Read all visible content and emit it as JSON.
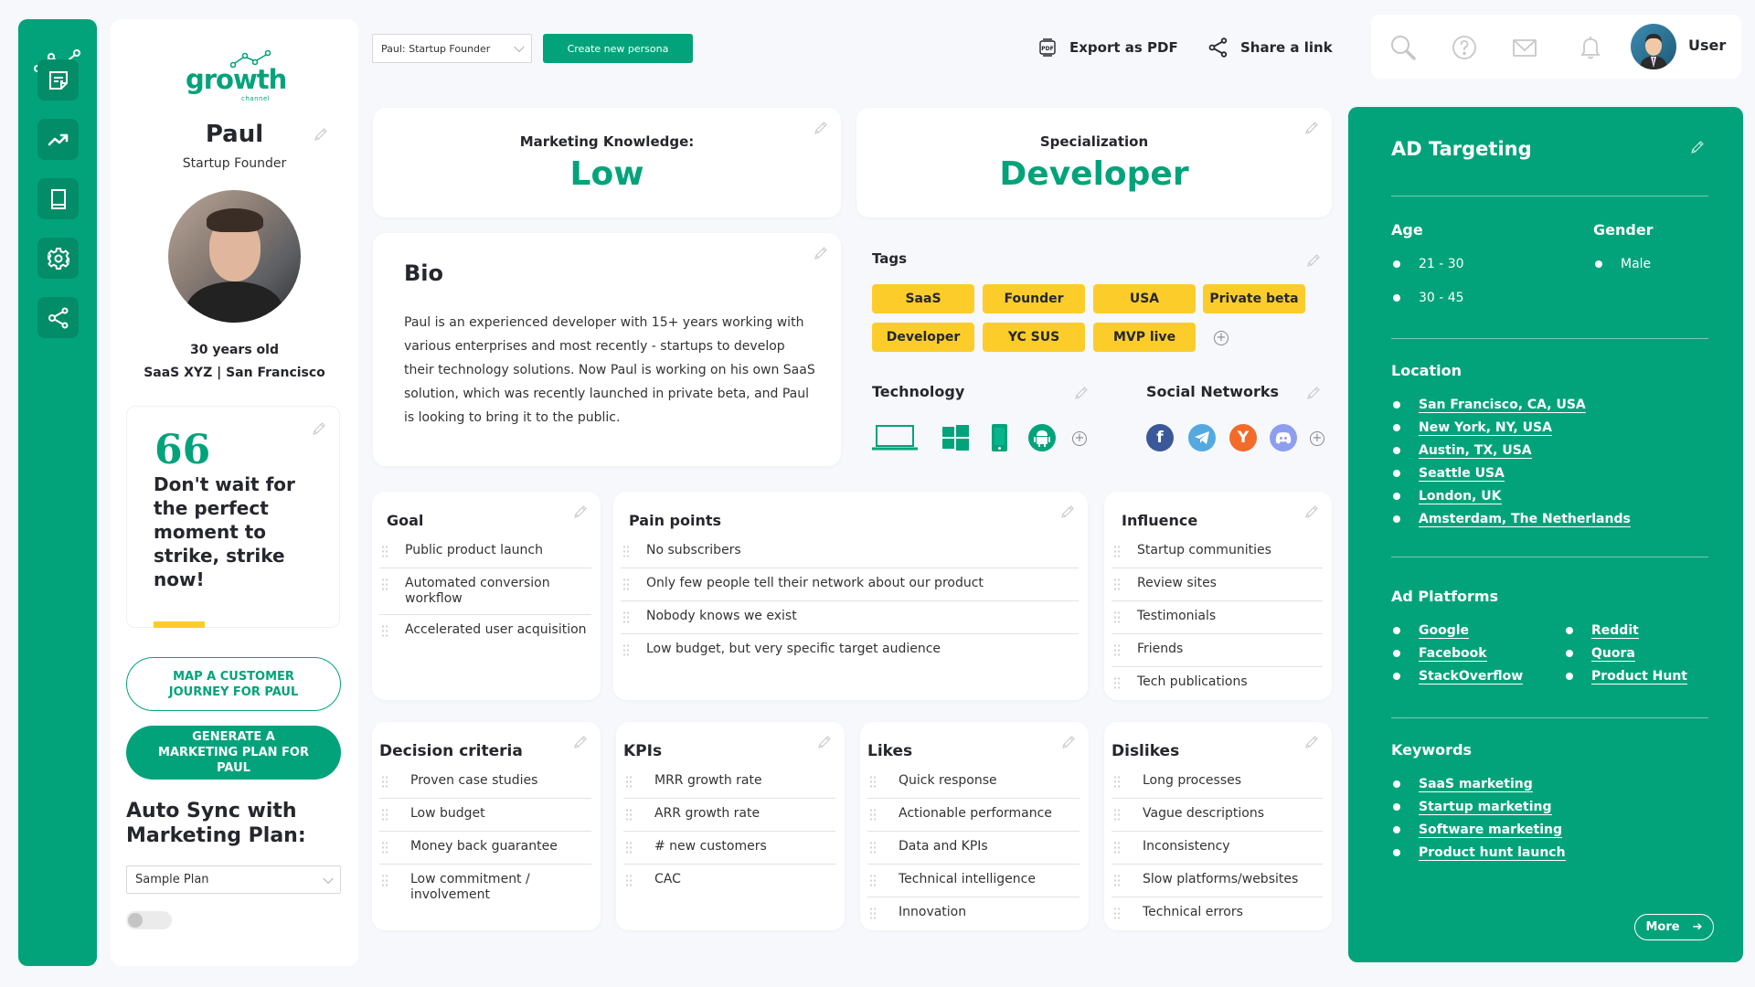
{
  "brand": {
    "name": "growth",
    "sub": "channel"
  },
  "sidebar": {
    "items": [
      {
        "name": "notes",
        "icon": "sticky-note-icon"
      },
      {
        "name": "growth",
        "icon": "trending-up-icon"
      },
      {
        "name": "library",
        "icon": "book-icon"
      },
      {
        "name": "settings",
        "icon": "gear-icon"
      },
      {
        "name": "share",
        "icon": "share-icon"
      }
    ]
  },
  "persona": {
    "name": "Paul",
    "role": "Startup Founder",
    "age": "30 years old",
    "company": "SaaS XYZ | San Francisco",
    "quote_mark": "66",
    "quote": "Don't wait for the perfect moment to strike, strike now!",
    "journey_button": "MAP A CUSTOMER JOURNEY FOR PAUL",
    "plan_button": "GENERATE A MARKETING PLAN FOR PAUL",
    "sync_title": "Auto Sync with Marketing Plan:",
    "plan_select_value": "Sample Plan",
    "sync_toggle_on": false
  },
  "topbar": {
    "persona_select_value": "Paul: Startup Founder",
    "create_button": "Create new persona",
    "export_label": "Export as PDF",
    "share_label": "Share a link",
    "user_name": "User"
  },
  "marketing": {
    "label": "Marketing Knowledge:",
    "value": "Low"
  },
  "specialization": {
    "label": "Specialization",
    "value": "Developer"
  },
  "bio": {
    "title": "Bio",
    "text": "Paul is an experienced developer with 15+ years working with various enterprises and most recently - startups to develop their technology solutions. Now Paul is working on his own SaaS solution, which was recently launched in private beta, and Paul is looking to bring it to the public."
  },
  "tags": {
    "title": "Tags",
    "items": [
      "SaaS",
      "Founder",
      "USA",
      "Private beta",
      "Developer",
      "YC SUS",
      "MVP live"
    ]
  },
  "technology": {
    "title": "Technology",
    "items": [
      "laptop-icon",
      "windows-icon",
      "mobile-icon",
      "android-icon"
    ]
  },
  "social": {
    "title": "Social Networks",
    "items": [
      "facebook-icon",
      "telegram-icon",
      "ycombinator-icon",
      "discord-icon"
    ]
  },
  "goal": {
    "title": "Goal",
    "items": [
      "Public product launch",
      "Automated conversion workflow",
      "Accelerated user acquisition"
    ]
  },
  "pain_points": {
    "title": "Pain points",
    "items": [
      "No subscribers",
      "Only few people tell their network about our product",
      "Nobody knows we exist",
      "Low budget, but very specific target audience"
    ]
  },
  "influence": {
    "title": "Influence",
    "items": [
      "Startup communities",
      "Review sites",
      "Testimonials",
      "Friends",
      "Tech publications"
    ]
  },
  "decision": {
    "title": "Decision criteria",
    "items": [
      "Proven case studies",
      "Low budget",
      "Money back guarantee",
      "Low commitment / involvement"
    ]
  },
  "kpis": {
    "title": "KPIs",
    "items": [
      "MRR growth rate",
      "ARR growth rate",
      "# new customers",
      "CAC"
    ]
  },
  "likes": {
    "title": "Likes",
    "items": [
      "Quick response",
      "Actionable performance",
      "Data and KPIs",
      "Technical intelligence",
      "Innovation"
    ]
  },
  "dislikes": {
    "title": "Dislikes",
    "items": [
      "Long processes",
      "Vague descriptions",
      "Inconsistency",
      "Slow platforms/websites",
      "Technical errors"
    ]
  },
  "ad_targeting": {
    "title": "AD Targeting",
    "age_title": "Age",
    "ages": [
      "21 - 30",
      "30 - 45"
    ],
    "gender_title": "Gender",
    "genders": [
      "Male"
    ],
    "location_title": "Location",
    "locations": [
      "San Francisco, CA, USA",
      "New York, NY, USA",
      "Austin, TX, USA",
      "Seattle USA",
      "London, UK",
      "Amsterdam, The Netherlands"
    ],
    "platforms_title": "Ad Platforms",
    "platforms_left": [
      "Google",
      "Facebook",
      "StackOverflow"
    ],
    "platforms_right": [
      "Reddit",
      "Quora",
      "Product Hunt"
    ],
    "keywords_title": "Keywords",
    "keywords": [
      "SaaS marketing",
      "Startup marketing",
      "Software marketing",
      "Product hunt launch"
    ],
    "more_label": "More"
  },
  "colors": {
    "brand": "#02a37a",
    "brand_dark": "#028c68",
    "tag": "#fccd2a",
    "background": "#f6f8fc"
  }
}
